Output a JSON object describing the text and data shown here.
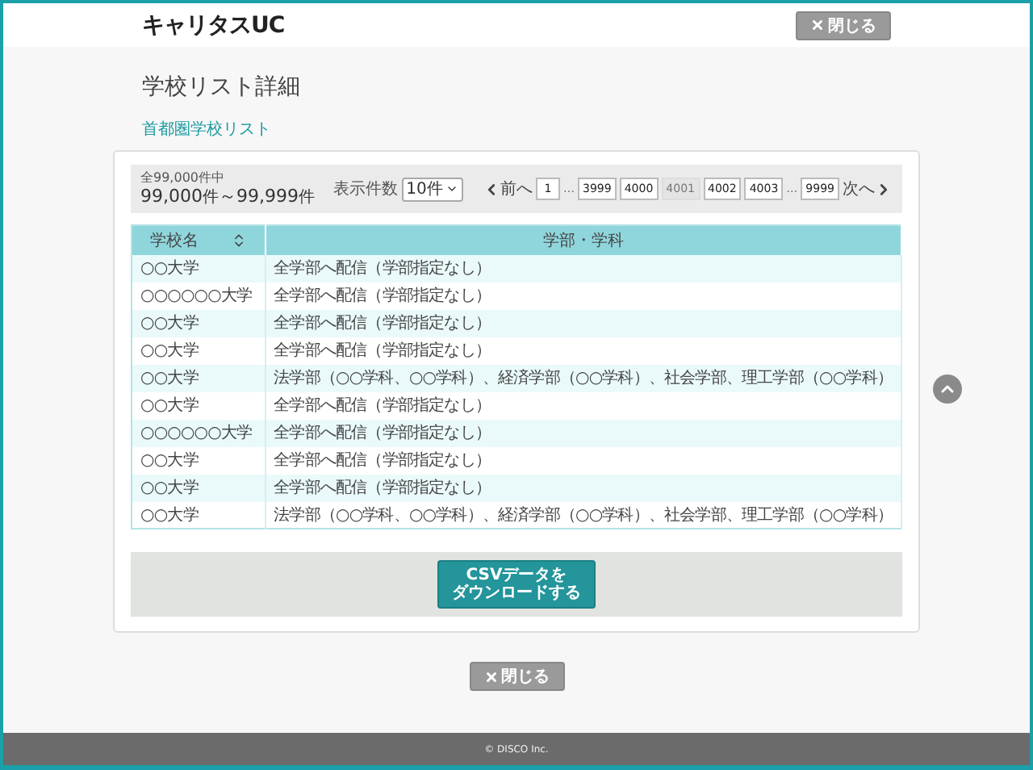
{
  "header": {
    "logo": "キャリタスUC",
    "close_button": "閉じる"
  },
  "page_title": "学校リスト詳細",
  "list_title": "首都圏学校リスト",
  "toolbar": {
    "total": "全99,000件中",
    "range_from": "99,000",
    "unit_from": "件",
    "tilde": "～",
    "range_to": "99,999",
    "unit_to": "件",
    "per_page_label": "表示件数",
    "per_page_value": "10件",
    "prev": "前へ",
    "next": "次へ",
    "pages": [
      {
        "kind": "page",
        "label": "1",
        "selected": false
      },
      {
        "kind": "gap",
        "label": "…"
      },
      {
        "kind": "page",
        "label": "3999",
        "selected": false
      },
      {
        "kind": "page",
        "label": "4000",
        "selected": false
      },
      {
        "kind": "page",
        "label": "4001",
        "selected": true
      },
      {
        "kind": "page",
        "label": "4002",
        "selected": false
      },
      {
        "kind": "page",
        "label": "4003",
        "selected": false
      },
      {
        "kind": "gap",
        "label": "…"
      },
      {
        "kind": "page",
        "label": "9999",
        "selected": false
      }
    ]
  },
  "table": {
    "columns": [
      "学校名",
      "学部・学科"
    ],
    "rows": [
      [
        "○○大学",
        "全学部へ配信（学部指定なし）"
      ],
      [
        "○○○○○○大学",
        "全学部へ配信（学部指定なし）"
      ],
      [
        "○○大学",
        "全学部へ配信（学部指定なし）"
      ],
      [
        "○○大学",
        "全学部へ配信（学部指定なし）"
      ],
      [
        "○○大学",
        "法学部（○○学科、○○学科）、経済学部（○○学科）、社会学部、理工学部（○○学科）"
      ],
      [
        "○○大学",
        "全学部へ配信（学部指定なし）"
      ],
      [
        "○○○○○○大学",
        "全学部へ配信（学部指定なし）"
      ],
      [
        "○○大学",
        "全学部へ配信（学部指定なし）"
      ],
      [
        "○○大学",
        "全学部へ配信（学部指定なし）"
      ],
      [
        "○○大学",
        "法学部（○○学科、○○学科）、経済学部（○○学科）、社会学部、理工学部（○○学科）"
      ]
    ]
  },
  "csv_button": [
    "CSVデータを",
    "ダウンロードする"
  ],
  "bottom_close_button": "閉じる",
  "footer": "© DISCO Inc."
}
